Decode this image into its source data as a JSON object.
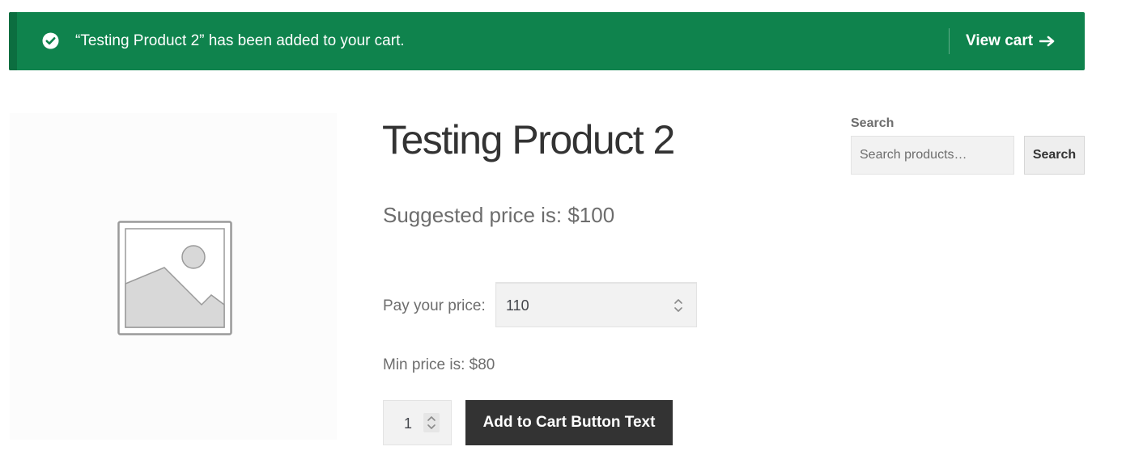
{
  "notice": {
    "message": "“Testing Product 2” has been added to your cart.",
    "action_label": "View cart",
    "icon": "check-circle-icon",
    "action_icon": "arrow-right-icon",
    "background_color": "#0f834d"
  },
  "product": {
    "title": "Testing Product 2",
    "image_icon": "image-placeholder-icon",
    "suggested_price": "Suggested price is: $100",
    "pay_label": "Pay your price:",
    "pay_value": "110",
    "min_price": "Min price is: $80",
    "quantity": "1",
    "add_to_cart_label": "Add to Cart Button Text"
  },
  "sidebar": {
    "search": {
      "title": "Search",
      "placeholder": "Search products…",
      "button_label": "Search"
    }
  }
}
